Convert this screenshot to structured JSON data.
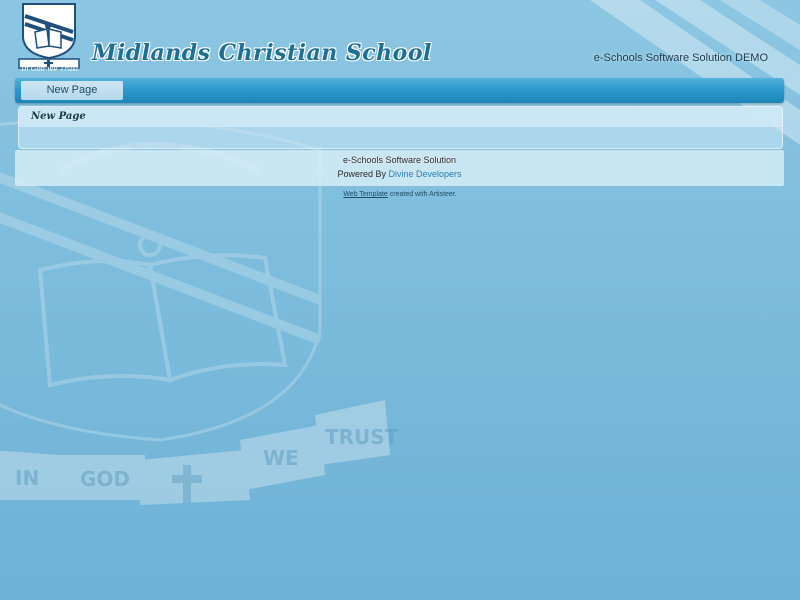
{
  "header": {
    "school_name": "Midlands Christian School",
    "motto": "In God we Trust",
    "demo_title": "e-Schools Software Solution DEMO"
  },
  "nav": {
    "items": [
      {
        "label": "New Page"
      }
    ]
  },
  "content": {
    "page_title": "New Page"
  },
  "footer": {
    "line1": "e-Schools Software Solution",
    "powered_prefix": "Powered By",
    "powered_link": "Divine Developers"
  },
  "credit": {
    "link": "Web Template",
    "suffix": "created with Artisteer."
  },
  "watermark": {
    "banner_words": [
      "IN",
      "GOD",
      "WE",
      "TRUST"
    ]
  },
  "colors": {
    "background": "#7dbcdc",
    "nav_bar": "#2a97c8",
    "nav_item": "#c2dfef",
    "school_name": "#1f6f93",
    "link": "#2b7fae"
  }
}
